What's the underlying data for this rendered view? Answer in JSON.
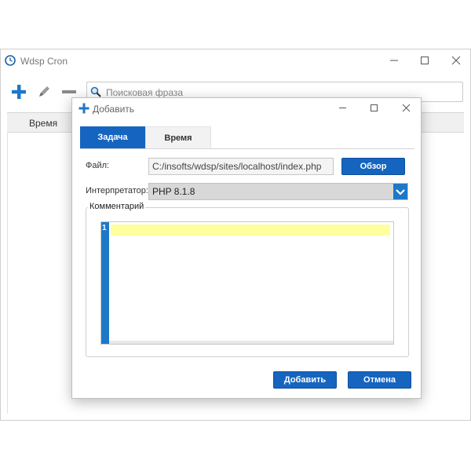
{
  "main_window": {
    "title": "Wdsp Cron",
    "search": {
      "placeholder": "Поисковая фраза",
      "value": ""
    },
    "list_columns": [
      "Время"
    ]
  },
  "dialog": {
    "title": "Добавить",
    "tabs": [
      {
        "label": "Задача",
        "active": true
      },
      {
        "label": "Время",
        "active": false
      }
    ],
    "file_label": "Файл:",
    "file_value": "C:/insofts/wdsp/sites/localhost/index.php",
    "browse_button": "Обзор",
    "interpreter_label": "Интерпретатор:",
    "interpreter_value": "PHP 8.1.8",
    "comment_label": "Комментарий",
    "editor": {
      "line_number": "1"
    },
    "add_button": "Добавить",
    "cancel_button": "Отмена"
  },
  "icons": {
    "app": "clock-icon",
    "add": "plus-icon",
    "edit": "pencil-icon",
    "remove": "minus-icon",
    "search": "magnifier-icon",
    "dropdown": "chevron-down-icon"
  },
  "colors": {
    "accent": "#1565c0",
    "plus": "#1e78c8",
    "editor_highlight": "#ffff9e"
  }
}
